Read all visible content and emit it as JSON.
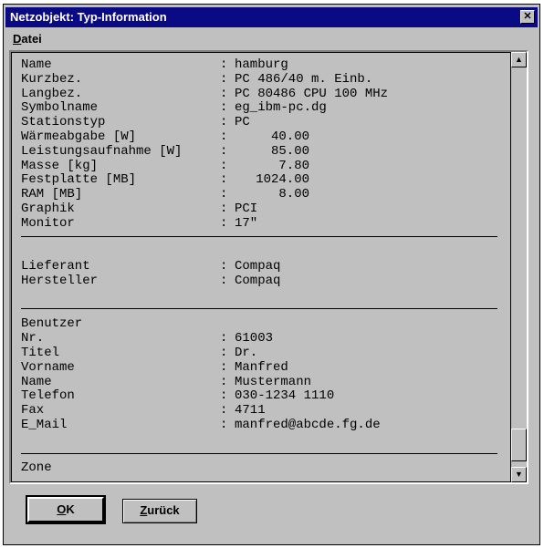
{
  "window": {
    "title": "Netzobjekt: Typ-Information",
    "close_glyph": "✕"
  },
  "menu": {
    "datei_first": "D",
    "datei_rest": "atei"
  },
  "section1": [
    {
      "label": "Name",
      "value": "hamburg"
    },
    {
      "label": "Kurzbez.",
      "value": "PC 486/40 m. Einb."
    },
    {
      "label": "Langbez.",
      "value": "PC 80486 CPU 100 MHz"
    },
    {
      "label": "Symbolname",
      "value": "eg_ibm-pc.dg"
    },
    {
      "label": "Stationstyp",
      "value": "PC"
    },
    {
      "label": "Wärmeabgabe [W]",
      "value": "40.00"
    },
    {
      "label": "Leistungsaufnahme [W]",
      "value": "85.00"
    },
    {
      "label": "Masse [kg]",
      "value": "7.80"
    },
    {
      "label": "Festplatte [MB]",
      "value": "1024.00"
    },
    {
      "label": "RAM [MB]",
      "value": "8.00"
    },
    {
      "label": "Graphik",
      "value": "PCI"
    },
    {
      "label": "Monitor",
      "value": "17\""
    }
  ],
  "section2": [
    {
      "label": "Lieferant",
      "value": "Compaq"
    },
    {
      "label": "Hersteller",
      "value": "Compaq"
    }
  ],
  "section3_heading": "Benutzer",
  "section3": [
    {
      "label": "Nr.",
      "value": "61003"
    },
    {
      "label": "Titel",
      "value": "Dr."
    },
    {
      "label": "Vorname",
      "value": "Manfred"
    },
    {
      "label": "Name",
      "value": "Mustermann"
    },
    {
      "label": "Telefon",
      "value": "030-1234 1110"
    },
    {
      "label": "Fax",
      "value": "4711"
    },
    {
      "label": "E_Mail",
      "value": "manfred@abcde.fg.de"
    }
  ],
  "section4_heading": "Zone",
  "separator": ":",
  "buttons": {
    "ok_first": "O",
    "ok_rest": "K",
    "back_first": "Z",
    "back_rest": "urück"
  },
  "scroll": {
    "up_glyph": "▲",
    "down_glyph": "▼"
  }
}
